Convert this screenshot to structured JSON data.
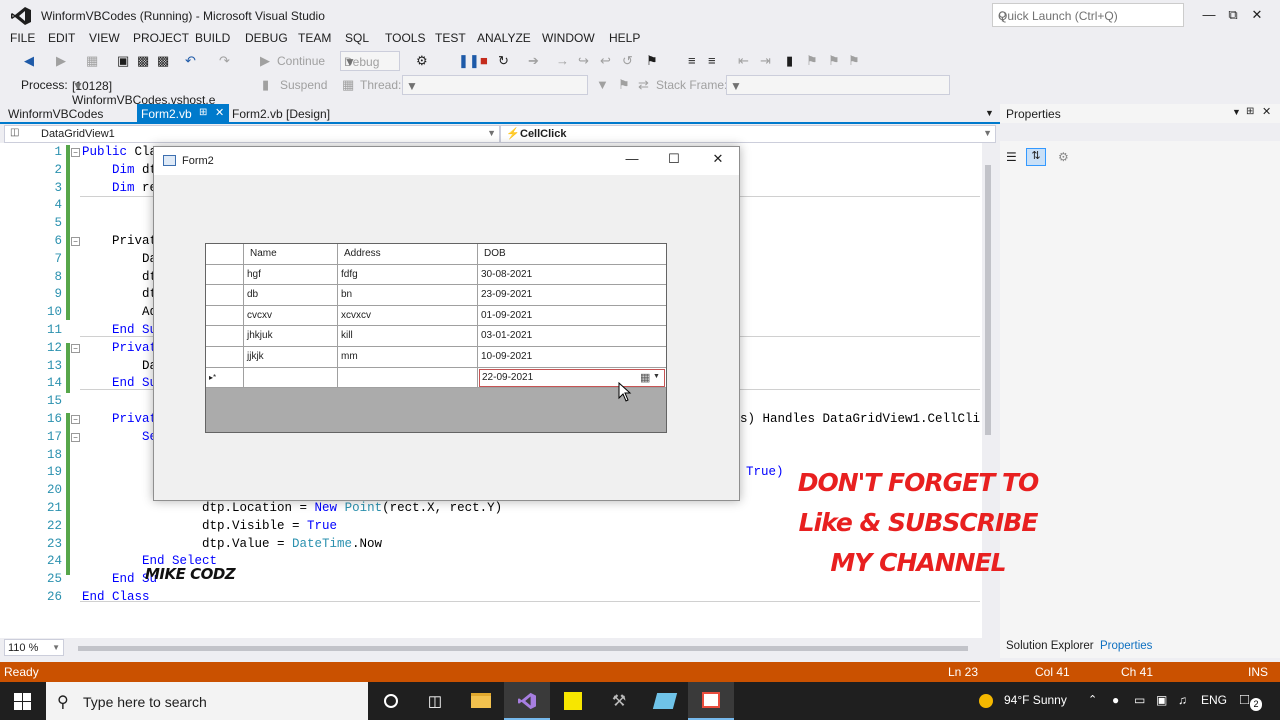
{
  "window": {
    "title": "WinformVBCodes (Running) - Microsoft Visual Studio",
    "quick_launch_placeholder": "Quick Launch (Ctrl+Q)"
  },
  "menu": [
    "FILE",
    "EDIT",
    "VIEW",
    "PROJECT",
    "BUILD",
    "DEBUG",
    "TEAM",
    "SQL",
    "TOOLS",
    "TEST",
    "ANALYZE",
    "WINDOW",
    "HELP"
  ],
  "toolbar": {
    "continue_label": "Continue",
    "config_value": "Debug",
    "process_label": "Process:",
    "process_value": "[10128] WinformVBCodes.vshost.e",
    "suspend_label": "Suspend",
    "thread_label": "Thread:",
    "stack_frame_label": "Stack Frame:"
  },
  "doc_tabs": [
    "WinformVBCodes",
    "Form2.vb",
    "Form2.vb [Design]"
  ],
  "nav": {
    "object": "DataGridView1",
    "member": "CellClick"
  },
  "editor": {
    "line_numbers": [
      "1",
      "2",
      "3",
      "4",
      "5",
      "6",
      "7",
      "8",
      "9",
      "10",
      "11",
      "12",
      "13",
      "14",
      "15",
      "16",
      "17",
      "18",
      "19",
      "20",
      "21",
      "22",
      "23",
      "24",
      "25",
      "26"
    ],
    "code": {
      "l1_kw": "Public",
      "l1_rest": " Cla",
      "l2": "Dim dt",
      "l3": "Dim re",
      "l6": "Privat",
      "l7": "Da",
      "l8": "dt",
      "l9": "dt",
      "l10": "Ad",
      "l11": "End Su",
      "l12": "Privat",
      "l13": "Da",
      "l14": "End Su",
      "l16": "Privat",
      "l16_tail": "s) Handles DataGridView1.CellCli",
      "l17": "Se",
      "l19_tail": "True)",
      "l21a": "dtp.Location = ",
      "l21b": "New",
      "l21c": " ",
      "l21d": "Point",
      "l21e": "(rect.X, rect.Y)",
      "l22a": "dtp.Visible = ",
      "l22b": "True",
      "l23a": "dtp.Value = ",
      "l23b": "DateTime",
      "l23c": ".Now",
      "l24": "End Select",
      "l25": "End Su",
      "l26": "End Class"
    },
    "zoom": "110 %"
  },
  "properties": {
    "title": "Properties",
    "tab_solution_explorer": "Solution Explorer",
    "tab_properties": "Properties"
  },
  "status": {
    "ready": "Ready",
    "ln": "Ln 23",
    "col": "Col 41",
    "ch": "Ch 41",
    "mode": "INS"
  },
  "form2": {
    "title": "Form2",
    "grid": {
      "columns": [
        "Name",
        "Address",
        "DOB"
      ],
      "rows": [
        [
          "hgf",
          "fdfg",
          "30-08-2021"
        ],
        [
          "db",
          "bn",
          "23-09-2021"
        ],
        [
          "cvcxv",
          "xcvxcv",
          "01-09-2021"
        ],
        [
          "jhkjuk",
          "kill",
          "03-01-2021"
        ],
        [
          "jjkjk",
          "mm",
          "10-09-2021"
        ]
      ],
      "new_row_marker": "▸*",
      "picker_value": "22-09-2021"
    }
  },
  "overlay": {
    "watermark": "MIKE CODZ",
    "promo_line1": "DON'T FORGET TO",
    "promo_line2": "Like & SUBSCRIBE",
    "promo_line3": "MY CHANNEL"
  },
  "taskbar": {
    "search_placeholder": "Type here to search",
    "weather": "94°F  Sunny",
    "language": "ENG",
    "notification_count": "2"
  },
  "colors": {
    "accent": "#007acc",
    "status_bar": "#ca5100",
    "promo_red": "#e82020"
  }
}
